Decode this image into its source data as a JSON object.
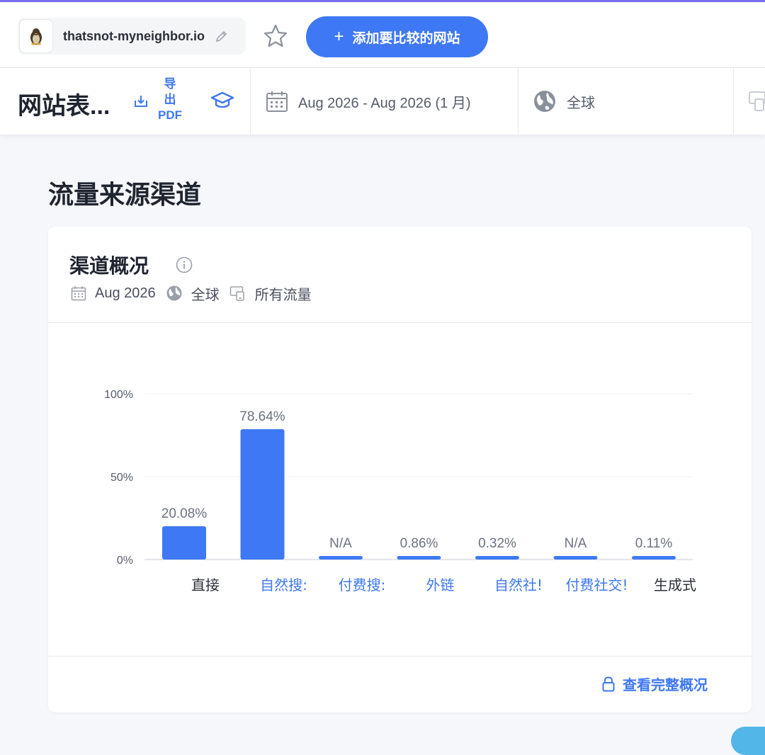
{
  "header": {
    "site_name": "thatsnot-myneighbor.io",
    "add_compare_label": "添加要比较的网站",
    "add_compare_plus": "+"
  },
  "filterbar": {
    "page_title": "网站表...",
    "export_label": "导出PDF",
    "export_lines": [
      "导",
      "出",
      "PDF"
    ],
    "date_range": "Aug 2026 - Aug 2026 (1 月)",
    "region": "全球"
  },
  "section": {
    "title": "流量来源渠道"
  },
  "card": {
    "title": "渠道概况",
    "meta_date": "Aug 2026",
    "meta_region": "全球",
    "meta_traffic": "所有流量",
    "full_link": "查看完整概况"
  },
  "colors": {
    "accent": "#3e78f4",
    "bar": "#3e78f4",
    "top_line": "#7a6ff0"
  },
  "icons": [
    "penguin-favicon-icon",
    "pencil-icon",
    "star-icon",
    "download-icon",
    "graduation-cap-icon",
    "calendar-icon",
    "globe-icon",
    "devices-icon",
    "info-icon",
    "lock-icon"
  ],
  "chart_data": {
    "type": "bar",
    "categories": [
      "直接",
      "自然搜索",
      "付费搜索",
      "外链",
      "自然社交",
      "付费社交",
      "生成式"
    ],
    "category_labels_shown": [
      "直接",
      "自然搜:",
      "付费搜:",
      "外链",
      "自然社!",
      "付费社交!",
      "生成式"
    ],
    "category_link": [
      false,
      true,
      true,
      true,
      true,
      true,
      false
    ],
    "values": [
      20.08,
      78.64,
      null,
      0.86,
      0.32,
      null,
      0.11
    ],
    "value_labels": [
      "20.08%",
      "78.64%",
      "N/A",
      "0.86%",
      "0.32%",
      "N/A",
      "0.11%"
    ],
    "yticks": [
      "100%",
      "50%",
      "0%"
    ],
    "ytick_values": [
      100,
      50,
      0
    ],
    "ylim": [
      0,
      100
    ],
    "grid": true
  }
}
